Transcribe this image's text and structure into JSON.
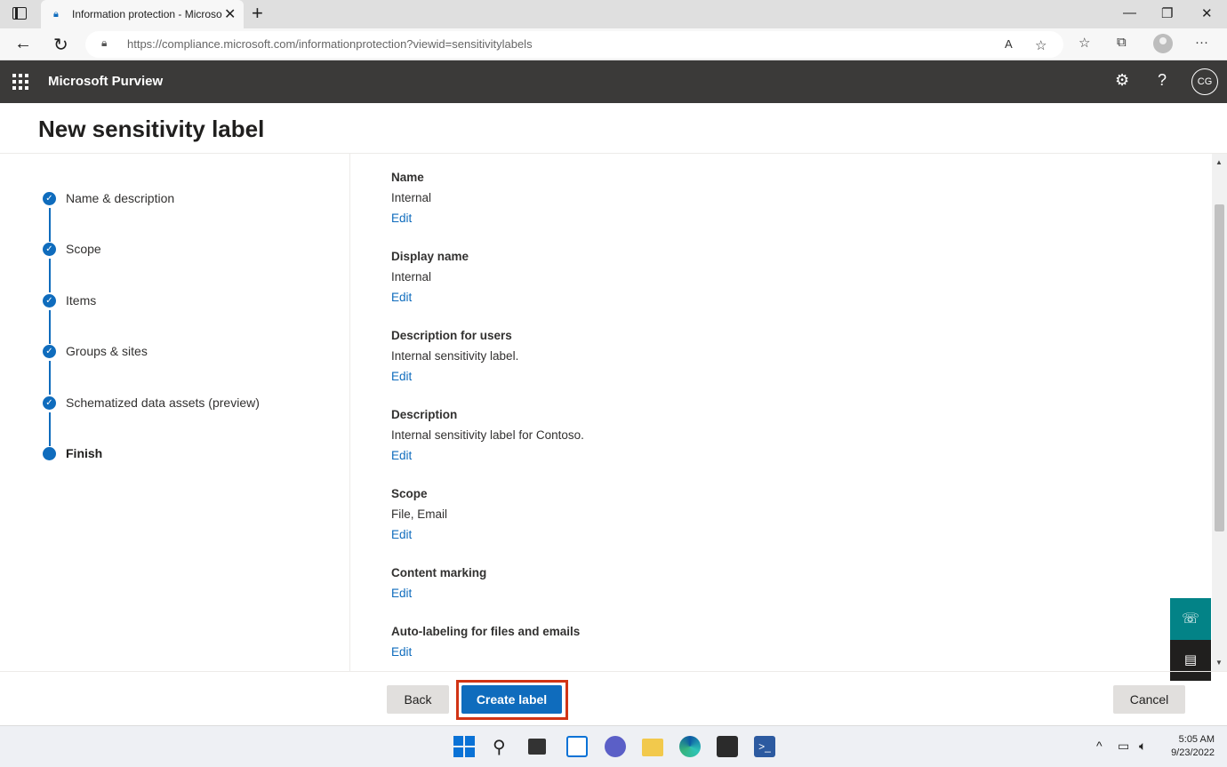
{
  "browser": {
    "tab_title": "Information protection - Microso",
    "url_domain": "https://compliance.microsoft.com",
    "url_path": "/informationprotection?viewid=sensitivitylabels"
  },
  "app": {
    "title": "Microsoft Purview",
    "avatar_initials": "CG"
  },
  "page": {
    "title": "New sensitivity label"
  },
  "steps": [
    {
      "label": "Name & description",
      "state": "done"
    },
    {
      "label": "Scope",
      "state": "done"
    },
    {
      "label": "Items",
      "state": "done"
    },
    {
      "label": "Groups & sites",
      "state": "done"
    },
    {
      "label": "Schematized data assets (preview)",
      "state": "done"
    },
    {
      "label": "Finish",
      "state": "current"
    }
  ],
  "summary": [
    {
      "heading": "Name",
      "value": "Internal",
      "edit": "Edit"
    },
    {
      "heading": "Display name",
      "value": "Internal",
      "edit": "Edit"
    },
    {
      "heading": "Description for users",
      "value": "Internal sensitivity label.",
      "edit": "Edit"
    },
    {
      "heading": "Description",
      "value": "Internal sensitivity label for Contoso.",
      "edit": "Edit"
    },
    {
      "heading": "Scope",
      "value": "File, Email",
      "edit": "Edit"
    },
    {
      "heading": "Content marking",
      "edit": "Edit"
    },
    {
      "heading": "Auto-labeling for files and emails",
      "edit": "Edit"
    }
  ],
  "footer": {
    "back": "Back",
    "create": "Create label",
    "cancel": "Cancel"
  },
  "taskbar": {
    "time": "5:05 AM",
    "date": "9/23/2022"
  },
  "colors": {
    "accent": "#0f6cbd",
    "highlight": "#d13415",
    "header": "#3b3a39"
  }
}
